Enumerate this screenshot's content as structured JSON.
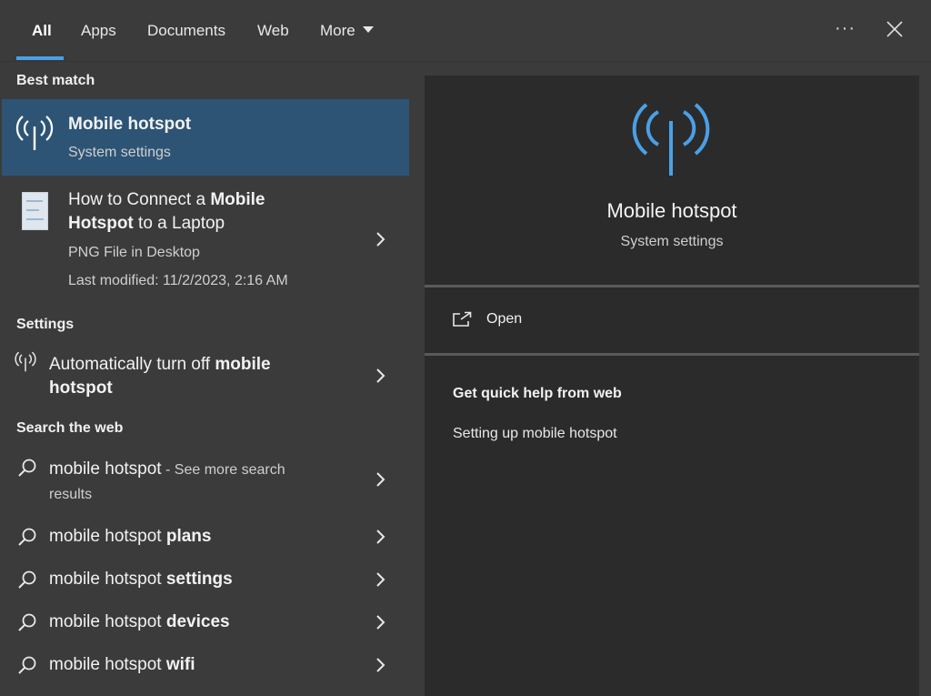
{
  "tabs": [
    {
      "label": "All"
    },
    {
      "label": "Apps"
    },
    {
      "label": "Documents"
    },
    {
      "label": "Web"
    },
    {
      "label": "More"
    }
  ],
  "top_actions": {
    "more_options": "···"
  },
  "sections": {
    "best_match": "Best match",
    "settings": "Settings",
    "search_web": "Search the web"
  },
  "best_match": {
    "title": "Mobile hotspot",
    "subtitle": "System settings"
  },
  "file_result": {
    "title_plain_1": "How to Connect a ",
    "title_bold_1": "Mobile",
    "title_bold_2": "Hotspot",
    "title_plain_2": " to a Laptop",
    "type": "PNG File in Desktop",
    "modified": "Last modified: 11/2/2023, 2:16 AM"
  },
  "settings_result": {
    "plain": "Automatically turn off ",
    "bold_1": "mobile",
    "bold_2": "hotspot"
  },
  "web_results": [
    {
      "plain": "mobile hotspot",
      "bold": "",
      "suffix": " - See more search",
      "suffix2": "results"
    },
    {
      "plain": "mobile hotspot ",
      "bold": "plans"
    },
    {
      "plain": "mobile hotspot ",
      "bold": "settings"
    },
    {
      "plain": "mobile hotspot ",
      "bold": "devices"
    },
    {
      "plain": "mobile hotspot ",
      "bold": "wifi"
    }
  ],
  "preview": {
    "title": "Mobile hotspot",
    "subtitle": "System settings",
    "open_label": "Open",
    "help_title": "Get quick help from web",
    "help_link": "Setting up mobile hotspot"
  },
  "colors": {
    "accent": "#4aa0e6",
    "selected_bg": "#2d5475",
    "pane_bg": "#3b3b3b",
    "card_bg": "#2b2b2b"
  },
  "icons": {
    "hotspot": "hotspot-icon",
    "search": "search-icon",
    "chevron": "chevron-right-icon",
    "open": "open-external-icon",
    "close": "close-icon"
  }
}
